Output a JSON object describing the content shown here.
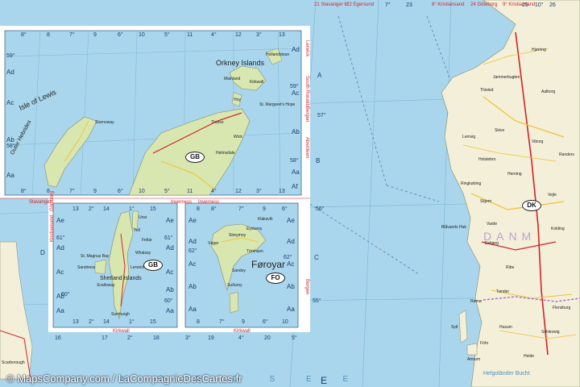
{
  "top_strip": {
    "labels": [
      "21 Stavanger 6°",
      "22 Egersund",
      "7°",
      "23",
      "8° Kristiansand",
      "24 Göteborg",
      "9° Kristiansand",
      "25",
      "10°",
      "26"
    ]
  },
  "inset_northern_scotland": {
    "grid_numbers_top": [
      "8°",
      "8",
      "7°",
      "9",
      "6°",
      "10",
      "5°",
      "11",
      "4°",
      "12",
      "3°",
      "13"
    ],
    "grid_numbers_bottom": [
      "8°",
      "8",
      "7°",
      "9",
      "6°",
      "10",
      "5°",
      "11",
      "4°",
      "12",
      "3°",
      "13"
    ],
    "row_letters_left": [
      "Ad",
      "Ac",
      "Ab",
      "Aa"
    ],
    "row_letters_right": [
      "Ad",
      "Ac",
      "Ab",
      "Aa",
      "Af"
    ],
    "latitudes": [
      "59°",
      "58°",
      "59°",
      "58°"
    ],
    "place_names": [
      "Orkney Islands",
      "Isle of Lewis",
      "Outer Hebrides",
      "Mainland",
      "Hoy",
      "Kirkwall",
      "Stornoway",
      "Thurso",
      "Wick",
      "St. Margaret's Hope",
      "Helmsdale",
      "Hollandstoun"
    ],
    "country_badge": "GB",
    "edge_labels": [
      "Stavanger",
      "Inverness",
      "Inverness",
      "Aberdeen",
      "Bergen",
      "South Ronalds",
      "Lerwick"
    ]
  },
  "inset_shetland": {
    "grid_numbers_top": [
      "13",
      "2°",
      "14",
      "1°",
      "15"
    ],
    "grid_numbers_bottom": [
      "13",
      "2°",
      "14",
      "1°",
      "15"
    ],
    "row_letters_left": [
      "Ae",
      "Ad",
      "Ac",
      "Ab",
      "Aa"
    ],
    "row_letters_right": [
      "Ae",
      "Ad",
      "Ac",
      "Ab",
      "Aa"
    ],
    "latitudes": [
      "61°",
      "60°",
      "61°",
      "60°"
    ],
    "place_names": [
      "Shetland Islands",
      "Unst",
      "Yell",
      "Lerwick",
      "Scalloway",
      "Sandness",
      "Sumburgh",
      "St. Magnus Bay",
      "Fetlar",
      "Whalsay"
    ],
    "country_badge": "GB",
    "edge_labels": [
      "Kristiansand",
      "Göteborg",
      "Kirkwall"
    ]
  },
  "inset_faroe": {
    "grid_numbers_top": [
      "8",
      "8°",
      "7°",
      "9",
      "6°"
    ],
    "grid_numbers_bottom": [
      "8",
      "7°",
      "9",
      "6°",
      "10"
    ],
    "row_letters_left": [
      "Ae",
      "Ad",
      "Ac",
      "Ab",
      "Aa"
    ],
    "row_letters_right": [
      "Ae",
      "Ad",
      "Ac",
      "Ab",
      "Aa"
    ],
    "latitudes": [
      "62°",
      "62°"
    ],
    "place_names": [
      "Føroyar",
      "Tórshavn",
      "Suðuroy",
      "Sandoy",
      "Vágar",
      "Streymoy",
      "Eysturoy",
      "Klaksvík"
    ],
    "country_badge": "FO",
    "edge_labels": [
      "Bergen",
      "Kirkwall"
    ]
  },
  "main_map": {
    "row_letters": [
      "A",
      "B",
      "C",
      "D",
      "E"
    ],
    "latitudes": [
      "57°",
      "56°",
      "55°"
    ],
    "grid_numbers_bottom": [
      "16",
      "17",
      "2°",
      "18",
      "3°",
      "19",
      "4°",
      "20",
      "5°"
    ],
    "place_names": [
      "Hjørring",
      "Aalborg",
      "Esbjerg",
      "Kolding",
      "Flensburg",
      "Holstebro",
      "Herning",
      "Ringkøbing",
      "Skjern",
      "Varde",
      "Ribe",
      "Tønder",
      "Viborg",
      "Randers",
      "Vejle",
      "Husum",
      "Schleswig",
      "Heide",
      "Thisted",
      "Skive",
      "Lemvig",
      "Jammerbugten",
      "Blåvands Huk",
      "Rømø",
      "Sylt",
      "Föhr",
      "Amrum",
      "Helgoländer Bucht",
      "Scarborough"
    ],
    "country_badge": "DK",
    "country_name": "DANM",
    "sea_name": "N O R D S E E"
  },
  "footer": {
    "copyright": "© MapsCompany.com / LaCompagnieDesCartes.fr"
  },
  "colors": {
    "sea": "#a9d6ec",
    "land": "#f3efd9",
    "road_red": "#d2232a",
    "road_yellow": "#f2c230",
    "frame": "#ffffff",
    "border_red": "#d2232a"
  }
}
